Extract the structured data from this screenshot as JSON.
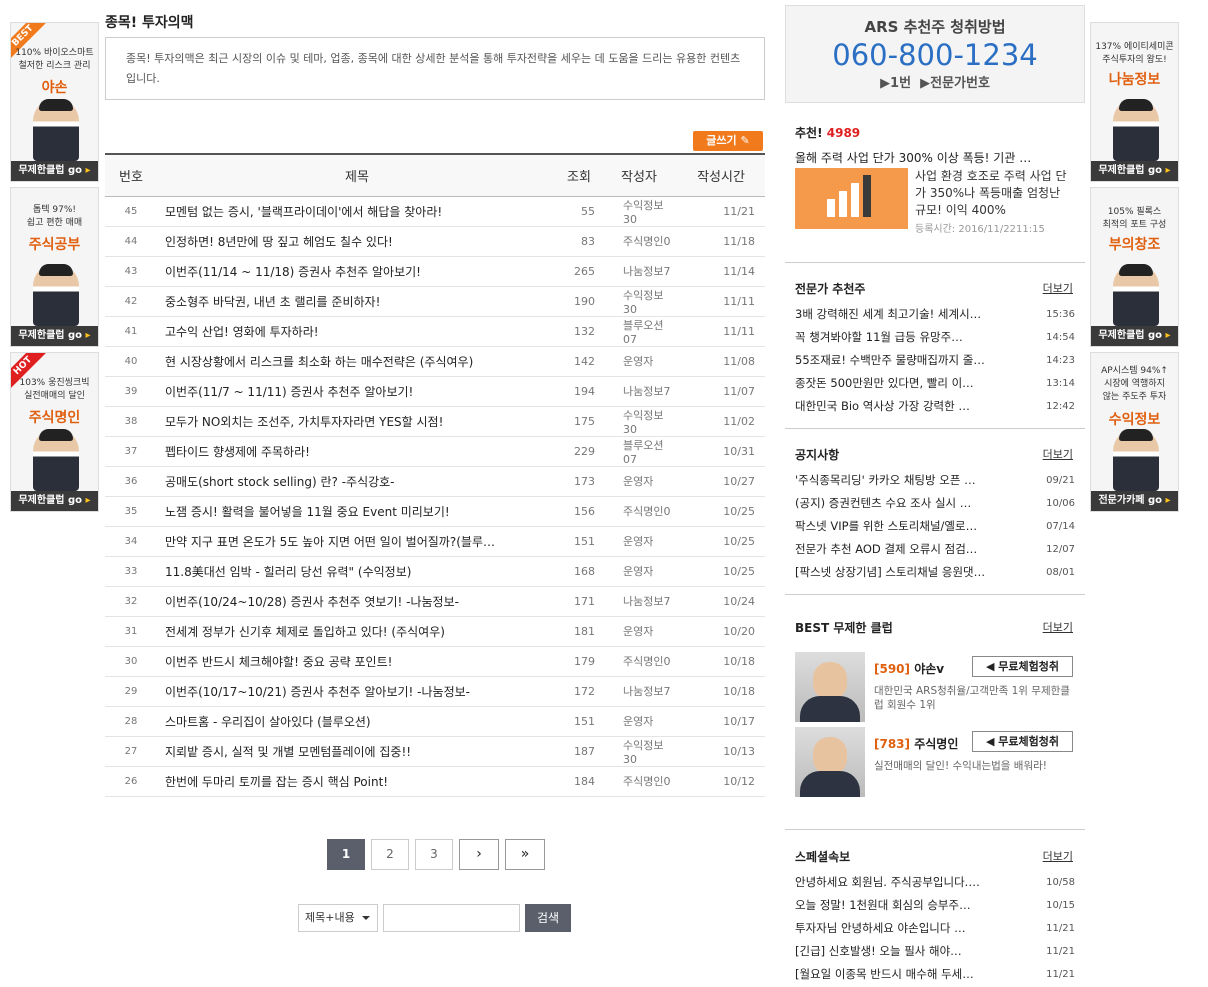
{
  "left_ads": [
    {
      "badge": "BEST",
      "badge_color": "#f07a1c",
      "sub": "110% 바이오스마트\n철저한 리스크 관리",
      "name": "야손",
      "go": "무제한클럽 go"
    },
    {
      "badge": "",
      "badge_color": "",
      "sub": "톱텍 97%!\n쉽고 편한 매매",
      "name": "주식공부",
      "go": "무제한클럽 go"
    },
    {
      "badge": "HOT",
      "badge_color": "#e02020",
      "sub": "103% 웅진씽크빅\n실전매매의 달인",
      "name": "주식명인",
      "go": "무제한클럽 go"
    }
  ],
  "right_ads": [
    {
      "sub": "137% 에이티세미콘\n주식투자의 왕도!",
      "name": "나눔정보",
      "go": "무제한클럽 go"
    },
    {
      "sub": "105% 필록스\n최적의 포트 구성",
      "name": "부의창조",
      "go": "무제한클럽 go"
    },
    {
      "sub": "AP시스템 94%↑\n시장에 역행하지\n않는 주도주 투자",
      "name": "수익정보",
      "go": "전문가카페 go"
    }
  ],
  "main": {
    "title": "종목! 투자의맥",
    "intro": "종목! 투자의맥은 최근 시장의 이슈 및 테마, 업종, 종목에 대한 상세한 분석을 통해 투자전략을 세우는 데 도움을 드리는 유용한 컨텐츠입니다.",
    "write_label": "글쓰기",
    "columns": {
      "no": "번호",
      "title": "제목",
      "views": "조회",
      "author": "작성자",
      "date": "작성시간"
    },
    "rows": [
      {
        "no": "45",
        "title": "모멘텀 없는 증시, '블랙프라이데이'에서 해답을 찾아라!",
        "views": "55",
        "author": "수익정보30",
        "date": "11/21"
      },
      {
        "no": "44",
        "title": "인정하면! 8년만에 땅 짚고 헤엄도 칠수 있다!",
        "views": "83",
        "author": "주식명인0",
        "date": "11/18"
      },
      {
        "no": "43",
        "title": "이번주(11/14 ~ 11/18) 증권사 추천주 알아보기!",
        "views": "265",
        "author": "나눔정보7",
        "date": "11/14"
      },
      {
        "no": "42",
        "title": "중소형주 바닥권, 내년 초 랠리를 준비하자!",
        "views": "190",
        "author": "수익정보30",
        "date": "11/11"
      },
      {
        "no": "41",
        "title": "고수익 산업! 영화에 투자하라!",
        "views": "132",
        "author": "블루오션07",
        "date": "11/11"
      },
      {
        "no": "40",
        "title": "현 시장상황에서 리스크를 최소화 하는 매수전략은 (주식여우)",
        "views": "142",
        "author": "운영자",
        "date": "11/08"
      },
      {
        "no": "39",
        "title": "이번주(11/7 ~ 11/11) 증권사 추천주 알아보기!",
        "views": "194",
        "author": "나눔정보7",
        "date": "11/07"
      },
      {
        "no": "38",
        "title": "모두가 NO외치는 조선주, 가치투자자라면 YES할 시점!",
        "views": "175",
        "author": "수익정보30",
        "date": "11/02"
      },
      {
        "no": "37",
        "title": "펩타이드 향생제에 주목하라!",
        "views": "229",
        "author": "블루오션07",
        "date": "10/31"
      },
      {
        "no": "36",
        "title": "공매도(short stock selling) 란? -주식강호-",
        "views": "173",
        "author": "운영자",
        "date": "10/27"
      },
      {
        "no": "35",
        "title": "노잼 증시! 활력을 불어넣을 11월 중요 Event 미리보기!",
        "views": "156",
        "author": "주식명인0",
        "date": "10/25"
      },
      {
        "no": "34",
        "title": "만약 지구 표면 온도가 5도 높아 지면 어떤 일이 벌어질까?(블루…",
        "views": "151",
        "author": "운영자",
        "date": "10/25"
      },
      {
        "no": "33",
        "title": "11.8美대선 임박 - 힐러리 당선 유력\" (수익정보)",
        "views": "168",
        "author": "운영자",
        "date": "10/25"
      },
      {
        "no": "32",
        "title": "이번주(10/24~10/28) 증권사 추천주 엿보기! -나눔정보-",
        "views": "171",
        "author": "나눔정보7",
        "date": "10/24"
      },
      {
        "no": "31",
        "title": "전세계 정부가 신기후 체제로 돌입하고 있다! (주식여우)",
        "views": "181",
        "author": "운영자",
        "date": "10/20"
      },
      {
        "no": "30",
        "title": "이번주 반드시 체크해야할! 중요 공략 포인트!",
        "views": "179",
        "author": "주식명인0",
        "date": "10/18"
      },
      {
        "no": "29",
        "title": "이번주(10/17~10/21) 증권사 추천주 알아보기! -나눔정보-",
        "views": "172",
        "author": "나눔정보7",
        "date": "10/18"
      },
      {
        "no": "28",
        "title": "스마트홈 - 우리집이 살아있다 (블루오션)",
        "views": "151",
        "author": "운영자",
        "date": "10/17"
      },
      {
        "no": "27",
        "title": "지뢰밭 증시, 실적 및 개별 모멘텀플레이에 집중!!",
        "views": "187",
        "author": "수익정보30",
        "date": "10/13"
      },
      {
        "no": "26",
        "title": "한번에 두마리 토끼를 잡는 증시 핵심 Point!",
        "views": "184",
        "author": "주식명인0",
        "date": "10/12"
      }
    ],
    "pager": {
      "pages": [
        "1",
        "2",
        "3"
      ],
      "current": "1",
      "next": "›",
      "last": "»"
    },
    "search": {
      "select": "제목+내용",
      "placeholder": "",
      "button": "검색"
    }
  },
  "side": {
    "ars": {
      "title": "ARS 추천주 청취방법",
      "phone": "060-800-1234",
      "steps": "▶1번  ▶전문가번호"
    },
    "recommend": {
      "label": "추천!",
      "count": "4989",
      "headline": "올해 주력 사업 단가 300% 이상 폭등! 기관 …",
      "desc": "사업 환경 호조로 주력 사업 단가 350%나 폭등매출 엄청난 규모! 이익 400%",
      "date": "등록시간: 2016/11/2211:15"
    },
    "expert": {
      "title": "전문가 추천주",
      "more": "더보기",
      "items": [
        {
          "t": "3배 강력해진 세계 최고기술! 세계시…",
          "d": "15:36"
        },
        {
          "t": "꼭 챙겨봐야할 11월 급등 유망주…",
          "d": "14:54"
        },
        {
          "t": "55조재료! 수백만주 물량매집까지 줄…",
          "d": "14:23"
        },
        {
          "t": "종잣돈 500만원만 있다면, 빨리 이…",
          "d": "13:14"
        },
        {
          "t": "대한민국 Bio 역사상 가장 강력한 …",
          "d": "12:42"
        }
      ]
    },
    "notice": {
      "title": "공지사항",
      "more": "더보기",
      "items": [
        {
          "t": "'주식종목리딩' 카카오 채팅방 오픈 …",
          "d": "09/21"
        },
        {
          "t": "(공지) 증권컨텐츠 수요 조사 실시 …",
          "d": "10/06"
        },
        {
          "t": "팍스넷 VIP를 위한 스토리채널/옐로…",
          "d": "07/14"
        },
        {
          "t": "전문가 추천 AOD 결제 오류시 점검…",
          "d": "12/07"
        },
        {
          "t": "[팍스넷 상장기념] 스토리채널 응원댓…",
          "d": "08/01"
        }
      ]
    },
    "best": {
      "title": "BEST 무제한 클럽",
      "more": "더보기",
      "items": [
        {
          "rank": "[590]",
          "name": "야손v",
          "btn": "무료체험청취",
          "desc": "대한민국 ARS청취율/고객만족 1위 무제한클럽 회원수 1위"
        },
        {
          "rank": "[783]",
          "name": "주식명인",
          "btn": "무료체험청취",
          "desc": "실전매매의 달인! 수익내는법을 배워라!"
        }
      ]
    },
    "special": {
      "title": "스페셜속보",
      "more": "더보기",
      "items": [
        {
          "t": "안녕하세요 회원님. 주식공부입니다.…",
          "d": "10/58"
        },
        {
          "t": "오늘 정말! 1천원대 회심의 승부주…",
          "d": "10/15"
        },
        {
          "t": "투자자님 안녕하세요 야손입니다 …",
          "d": "11/21"
        },
        {
          "t": "[긴급] 신호발생! 오늘 필사 해야…",
          "d": "11/21"
        },
        {
          "t": "[월요일 이종목 반드시 매수해 두세…",
          "d": "11/21"
        }
      ]
    }
  }
}
